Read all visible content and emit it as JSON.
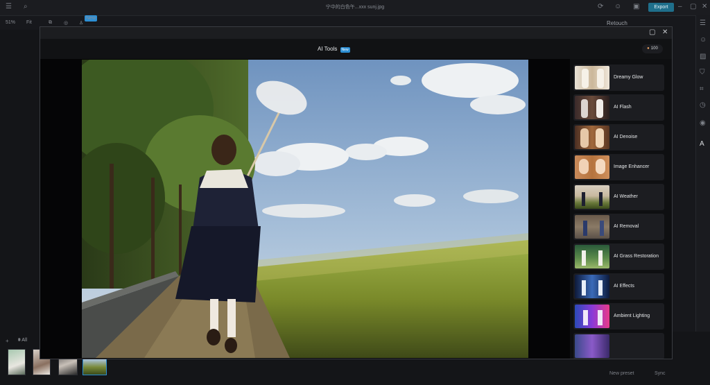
{
  "app": {
    "file_title": "宁中的白色午...xxx sunj.jpg",
    "export_label": "Export",
    "zoom_label": "51%",
    "fit_label": "Fit",
    "retouch_label": "Retouch",
    "badge_new": "New",
    "filter_label": "All",
    "new_preset_label": "New preset",
    "sync_label": "Sync"
  },
  "modal": {
    "title": "AI Tools",
    "badge": "New",
    "credits": "100"
  },
  "tools": [
    {
      "label": "Dreamy Glow",
      "icon": "dreamy-glow-thumb"
    },
    {
      "label": "AI Flash",
      "icon": "ai-flash-thumb"
    },
    {
      "label": "AI Denoise",
      "icon": "ai-denoise-thumb"
    },
    {
      "label": "Image Enhancer",
      "icon": "image-enhancer-thumb"
    },
    {
      "label": "AI Weather",
      "icon": "ai-weather-thumb"
    },
    {
      "label": "AI Removal",
      "icon": "ai-removal-thumb"
    },
    {
      "label": "AI Grass Restoration",
      "icon": "ai-grass-restoration-thumb"
    },
    {
      "label": "AI Effects",
      "icon": "ai-effects-thumb"
    },
    {
      "label": "Ambient Lighting",
      "icon": "ambient-lighting-thumb"
    }
  ],
  "colors": {
    "accent": "#1f6f8b",
    "badge": "#2d8fd4",
    "card": "#1c1d21"
  }
}
